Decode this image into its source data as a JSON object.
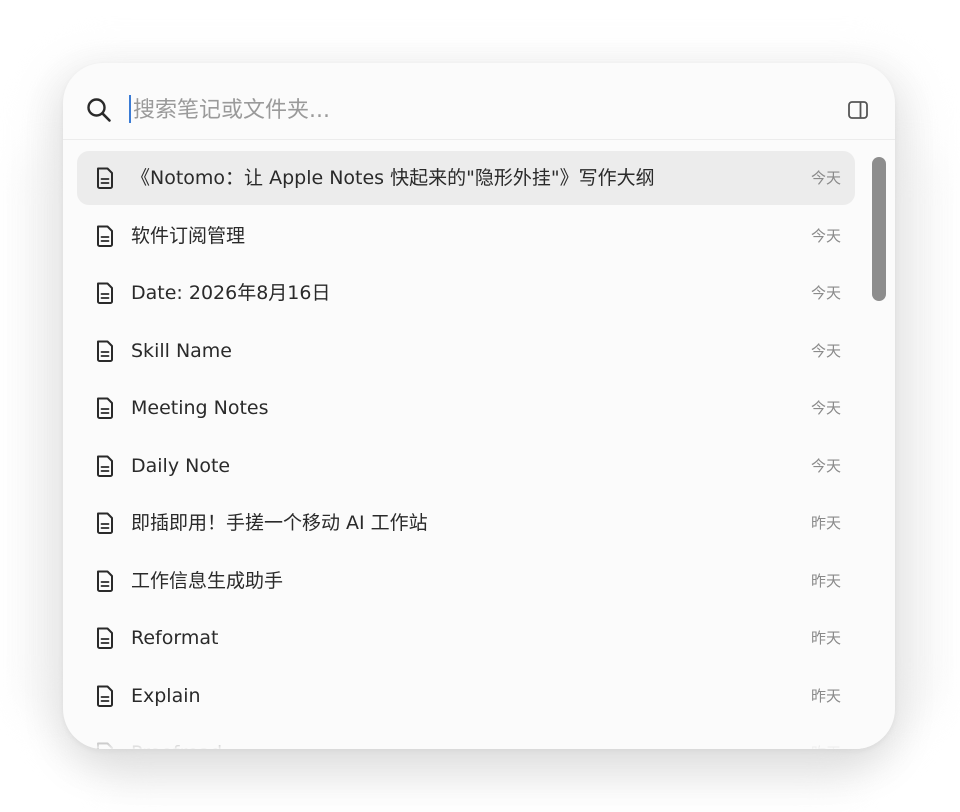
{
  "search": {
    "placeholder": "搜索笔记或文件夹...",
    "value": ""
  },
  "icons": {
    "search": "search-icon",
    "sidebar_toggle": "sidebar-toggle-icon",
    "document": "document-icon"
  },
  "colors": {
    "accent": "#3a7bd5",
    "selected_row": "#ececec",
    "scroll_thumb": "#8d8d8d"
  },
  "notes": [
    {
      "title": "《Notomo：让 Apple Notes 快起来的\"隐形外挂\"》写作大纲",
      "date": "今天",
      "selected": true
    },
    {
      "title": "软件订阅管理",
      "date": "今天"
    },
    {
      "title": "Date: 2026年8月16日",
      "date": "今天"
    },
    {
      "title": "Skill Name",
      "date": "今天"
    },
    {
      "title": "Meeting Notes",
      "date": "今天"
    },
    {
      "title": "Daily Note",
      "date": "今天"
    },
    {
      "title": "即插即用！手搓一个移动 AI 工作站",
      "date": "昨天"
    },
    {
      "title": "工作信息生成助手",
      "date": "昨天"
    },
    {
      "title": "Reformat",
      "date": "昨天"
    },
    {
      "title": "Explain",
      "date": "昨天"
    },
    {
      "title": "Proofread",
      "date": "昨天"
    }
  ]
}
